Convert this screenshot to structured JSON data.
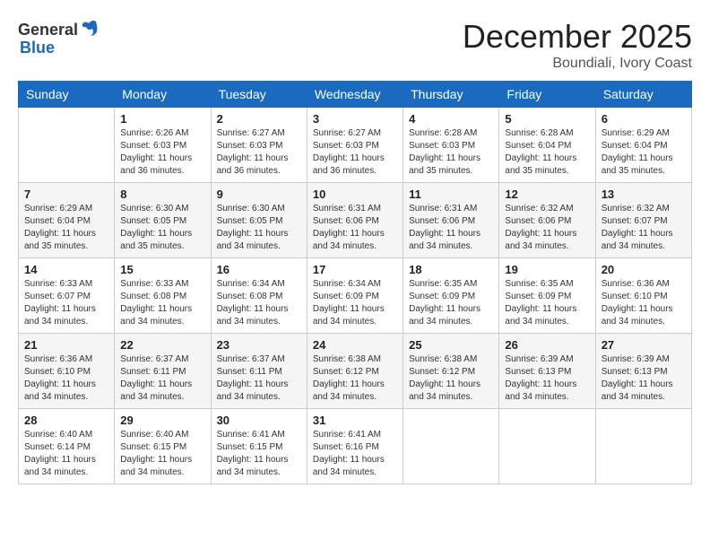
{
  "logo": {
    "general": "General",
    "blue": "Blue"
  },
  "header": {
    "month": "December 2025",
    "location": "Boundiali, Ivory Coast"
  },
  "weekdays": [
    "Sunday",
    "Monday",
    "Tuesday",
    "Wednesday",
    "Thursday",
    "Friday",
    "Saturday"
  ],
  "weeks": [
    [
      {
        "day": "",
        "info": ""
      },
      {
        "day": "1",
        "info": "Sunrise: 6:26 AM\nSunset: 6:03 PM\nDaylight: 11 hours\nand 36 minutes."
      },
      {
        "day": "2",
        "info": "Sunrise: 6:27 AM\nSunset: 6:03 PM\nDaylight: 11 hours\nand 36 minutes."
      },
      {
        "day": "3",
        "info": "Sunrise: 6:27 AM\nSunset: 6:03 PM\nDaylight: 11 hours\nand 36 minutes."
      },
      {
        "day": "4",
        "info": "Sunrise: 6:28 AM\nSunset: 6:03 PM\nDaylight: 11 hours\nand 35 minutes."
      },
      {
        "day": "5",
        "info": "Sunrise: 6:28 AM\nSunset: 6:04 PM\nDaylight: 11 hours\nand 35 minutes."
      },
      {
        "day": "6",
        "info": "Sunrise: 6:29 AM\nSunset: 6:04 PM\nDaylight: 11 hours\nand 35 minutes."
      }
    ],
    [
      {
        "day": "7",
        "info": "Sunrise: 6:29 AM\nSunset: 6:04 PM\nDaylight: 11 hours\nand 35 minutes."
      },
      {
        "day": "8",
        "info": "Sunrise: 6:30 AM\nSunset: 6:05 PM\nDaylight: 11 hours\nand 35 minutes."
      },
      {
        "day": "9",
        "info": "Sunrise: 6:30 AM\nSunset: 6:05 PM\nDaylight: 11 hours\nand 34 minutes."
      },
      {
        "day": "10",
        "info": "Sunrise: 6:31 AM\nSunset: 6:06 PM\nDaylight: 11 hours\nand 34 minutes."
      },
      {
        "day": "11",
        "info": "Sunrise: 6:31 AM\nSunset: 6:06 PM\nDaylight: 11 hours\nand 34 minutes."
      },
      {
        "day": "12",
        "info": "Sunrise: 6:32 AM\nSunset: 6:06 PM\nDaylight: 11 hours\nand 34 minutes."
      },
      {
        "day": "13",
        "info": "Sunrise: 6:32 AM\nSunset: 6:07 PM\nDaylight: 11 hours\nand 34 minutes."
      }
    ],
    [
      {
        "day": "14",
        "info": "Sunrise: 6:33 AM\nSunset: 6:07 PM\nDaylight: 11 hours\nand 34 minutes."
      },
      {
        "day": "15",
        "info": "Sunrise: 6:33 AM\nSunset: 6:08 PM\nDaylight: 11 hours\nand 34 minutes."
      },
      {
        "day": "16",
        "info": "Sunrise: 6:34 AM\nSunset: 6:08 PM\nDaylight: 11 hours\nand 34 minutes."
      },
      {
        "day": "17",
        "info": "Sunrise: 6:34 AM\nSunset: 6:09 PM\nDaylight: 11 hours\nand 34 minutes."
      },
      {
        "day": "18",
        "info": "Sunrise: 6:35 AM\nSunset: 6:09 PM\nDaylight: 11 hours\nand 34 minutes."
      },
      {
        "day": "19",
        "info": "Sunrise: 6:35 AM\nSunset: 6:09 PM\nDaylight: 11 hours\nand 34 minutes."
      },
      {
        "day": "20",
        "info": "Sunrise: 6:36 AM\nSunset: 6:10 PM\nDaylight: 11 hours\nand 34 minutes."
      }
    ],
    [
      {
        "day": "21",
        "info": "Sunrise: 6:36 AM\nSunset: 6:10 PM\nDaylight: 11 hours\nand 34 minutes."
      },
      {
        "day": "22",
        "info": "Sunrise: 6:37 AM\nSunset: 6:11 PM\nDaylight: 11 hours\nand 34 minutes."
      },
      {
        "day": "23",
        "info": "Sunrise: 6:37 AM\nSunset: 6:11 PM\nDaylight: 11 hours\nand 34 minutes."
      },
      {
        "day": "24",
        "info": "Sunrise: 6:38 AM\nSunset: 6:12 PM\nDaylight: 11 hours\nand 34 minutes."
      },
      {
        "day": "25",
        "info": "Sunrise: 6:38 AM\nSunset: 6:12 PM\nDaylight: 11 hours\nand 34 minutes."
      },
      {
        "day": "26",
        "info": "Sunrise: 6:39 AM\nSunset: 6:13 PM\nDaylight: 11 hours\nand 34 minutes."
      },
      {
        "day": "27",
        "info": "Sunrise: 6:39 AM\nSunset: 6:13 PM\nDaylight: 11 hours\nand 34 minutes."
      }
    ],
    [
      {
        "day": "28",
        "info": "Sunrise: 6:40 AM\nSunset: 6:14 PM\nDaylight: 11 hours\nand 34 minutes."
      },
      {
        "day": "29",
        "info": "Sunrise: 6:40 AM\nSunset: 6:15 PM\nDaylight: 11 hours\nand 34 minutes."
      },
      {
        "day": "30",
        "info": "Sunrise: 6:41 AM\nSunset: 6:15 PM\nDaylight: 11 hours\nand 34 minutes."
      },
      {
        "day": "31",
        "info": "Sunrise: 6:41 AM\nSunset: 6:16 PM\nDaylight: 11 hours\nand 34 minutes."
      },
      {
        "day": "",
        "info": ""
      },
      {
        "day": "",
        "info": ""
      },
      {
        "day": "",
        "info": ""
      }
    ]
  ]
}
